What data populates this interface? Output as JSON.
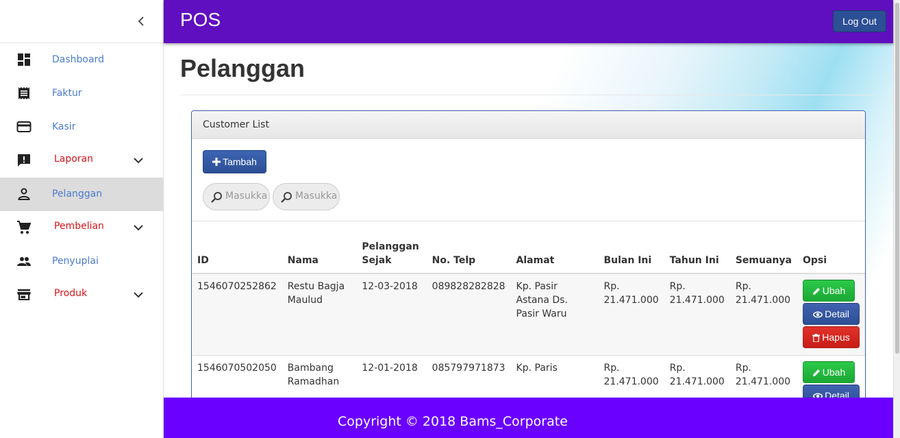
{
  "app": {
    "brand": "POS",
    "logout_label": "Log Out"
  },
  "sidebar": {
    "items": [
      {
        "label": "Dashboard",
        "icon": "dashboard-icon"
      },
      {
        "label": "Faktur",
        "icon": "receipt-icon"
      },
      {
        "label": "Kasir",
        "icon": "credit-card-icon"
      },
      {
        "label": "Laporan",
        "icon": "report-icon"
      },
      {
        "label": "Pelanggan",
        "icon": "person-icon"
      },
      {
        "label": "Pembelian",
        "icon": "cart-icon"
      },
      {
        "label": "Penyuplai",
        "icon": "people-icon"
      },
      {
        "label": "Produk",
        "icon": "store-icon"
      }
    ]
  },
  "page": {
    "title": "Pelanggan"
  },
  "panel": {
    "heading": "Customer List",
    "add_label": "Tambah",
    "search_placeholders": [
      "Masukka",
      "Masukka"
    ]
  },
  "table": {
    "headers": [
      "ID",
      "Nama",
      "Pelanggan Sejak",
      "No. Telp",
      "Alamat",
      "Bulan Ini",
      "Tahun Ini",
      "Semuanya",
      "Opsi"
    ],
    "rows": [
      {
        "id": "1546070252862",
        "nama": "Restu Bagja Maulud",
        "sejak": "12-03-2018",
        "telp": "089828282828",
        "alamat": "Kp. Pasir Astana Ds. Pasir Waru",
        "bulan": "Rp. 21.471.000",
        "tahun": "Rp. 21.471.000",
        "semua": "Rp. 21.471.000"
      },
      {
        "id": "1546070502050",
        "nama": "Bambang Ramadhan",
        "sejak": "12-01-2018",
        "telp": "085797971873",
        "alamat": "Kp. Paris",
        "bulan": "Rp. 21.471.000",
        "tahun": "Rp. 21.471.000",
        "semua": "Rp. 21.471.000"
      }
    ],
    "actions": {
      "edit": "Ubah",
      "detail": "Detail",
      "delete": "Hapus"
    }
  },
  "footer": {
    "copyright": "Copyright © 2018 Bams_Corporate"
  },
  "colors": {
    "header": "#5f0fc0",
    "footer": "#6a00ff",
    "primary": "#2c4f95",
    "success": "#1aa833",
    "danger": "#c81c16",
    "link": "#4a7bd0",
    "link_red": "#d8141a"
  }
}
